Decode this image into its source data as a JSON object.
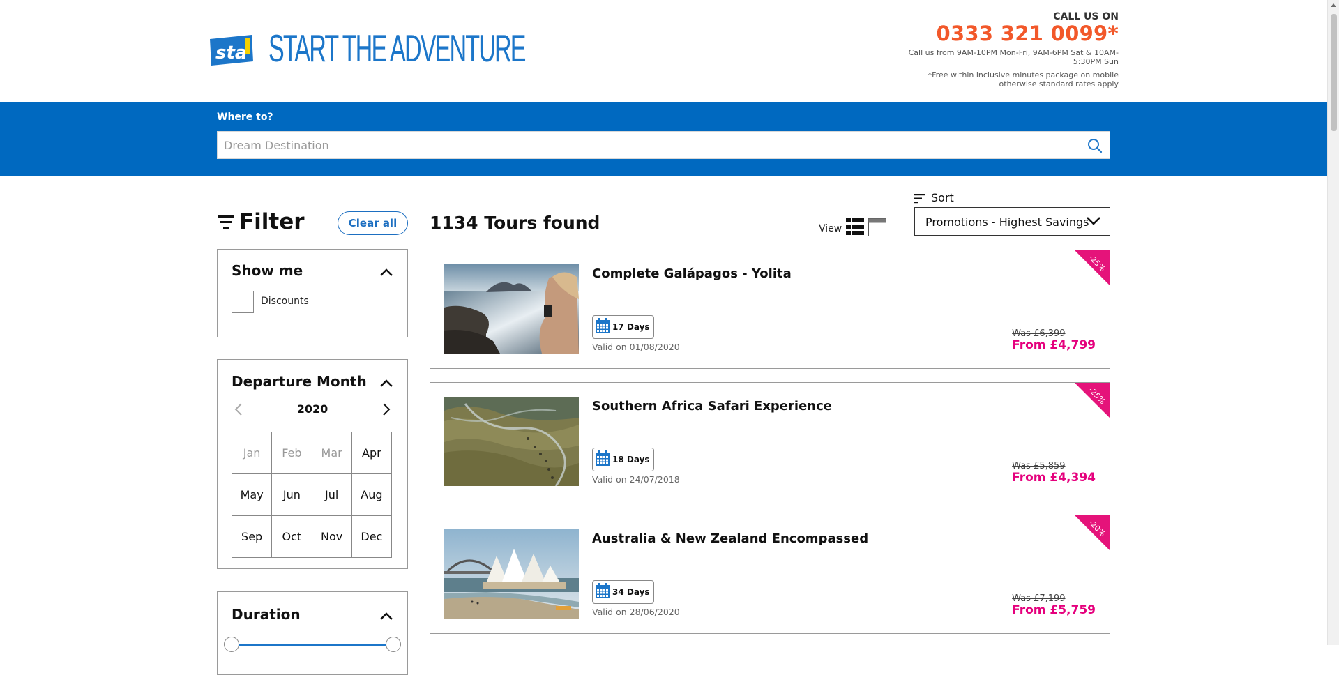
{
  "header": {
    "brand_mark": "sta travel",
    "slogan": "START THE ADVENTURE",
    "call_label": "CALL US ON",
    "phone": "0333 321 0099*",
    "hours": "Call us from 9AM-10PM Mon-Fri, 9AM-6PM Sat & 10AM-5:30PM Sun",
    "rates": "*Free within inclusive minutes package on mobile otherwise standard rates apply"
  },
  "search": {
    "label": "Where to?",
    "placeholder": "Dream Destination",
    "value": ""
  },
  "filter": {
    "title": "Filter",
    "clear_label": "Clear all",
    "show_me": {
      "title": "Show me",
      "options": [
        {
          "label": "Discounts",
          "checked": false
        }
      ]
    },
    "departure_month": {
      "title": "Departure Month",
      "year": "2020",
      "months": [
        {
          "label": "Jan",
          "disabled": true
        },
        {
          "label": "Feb",
          "disabled": true
        },
        {
          "label": "Mar",
          "disabled": true
        },
        {
          "label": "Apr",
          "disabled": false
        },
        {
          "label": "May",
          "disabled": false
        },
        {
          "label": "Jun",
          "disabled": false
        },
        {
          "label": "Jul",
          "disabled": false
        },
        {
          "label": "Aug",
          "disabled": false
        },
        {
          "label": "Sep",
          "disabled": false
        },
        {
          "label": "Oct",
          "disabled": false
        },
        {
          "label": "Nov",
          "disabled": false
        },
        {
          "label": "Dec",
          "disabled": false
        }
      ]
    },
    "duration": {
      "title": "Duration"
    }
  },
  "results": {
    "count_text": "1134 Tours found",
    "view_label": "View",
    "sort_label": "Sort",
    "sort_value": "Promotions - Highest Savings",
    "tours": [
      {
        "title": "Complete Galápagos - Yolita",
        "days": "17 Days",
        "valid": "Valid on 01/08/2020",
        "was": "Was £6,399",
        "from": "From £4,799",
        "discount": "-25%"
      },
      {
        "title": "Southern Africa Safari Experience",
        "days": "18 Days",
        "valid": "Valid on 24/07/2018",
        "was": "Was £5,859",
        "from": "From £4,394",
        "discount": "-25%"
      },
      {
        "title": "Australia & New Zealand Encompassed",
        "days": "34 Days",
        "valid": "Valid on 28/06/2020",
        "was": "Was £7,199",
        "from": "From £5,759",
        "discount": "-20%"
      }
    ]
  },
  "colors": {
    "brand_blue": "#0069c0",
    "phone_orange": "#f2582a",
    "price_pink": "#e5007d"
  }
}
